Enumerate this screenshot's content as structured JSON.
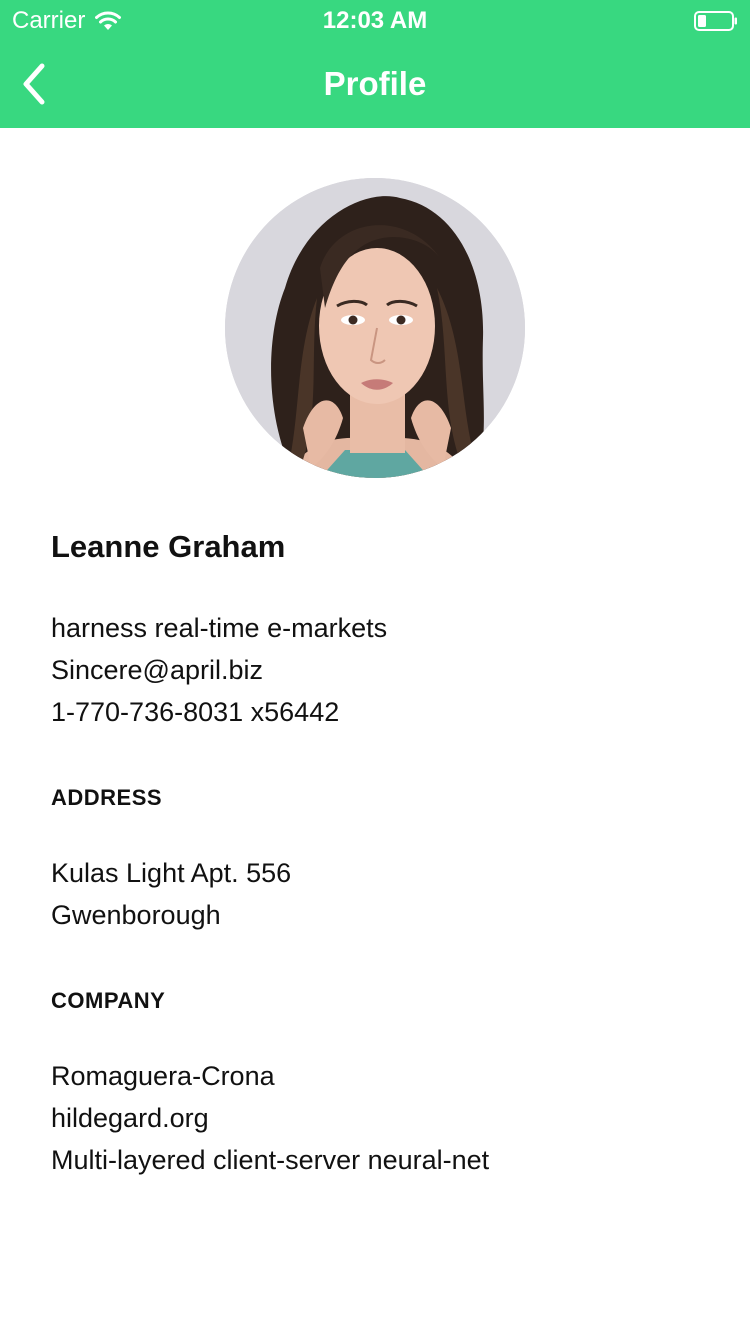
{
  "status_bar": {
    "carrier": "Carrier",
    "time": "12:03 AM",
    "battery_level": 0.25
  },
  "nav": {
    "title": "Profile",
    "back_icon": "chevron-left-icon"
  },
  "colors": {
    "header_bg": "#38d880",
    "header_text": "#ffffff",
    "body_text": "#111111"
  },
  "profile": {
    "name": "Leanne Graham",
    "catch_phrase": "harness real-time e-markets",
    "email": "Sincere@april.biz",
    "phone": "1-770-736-8031 x56442"
  },
  "address": {
    "label": "ADDRESS",
    "street": "Kulas Light Apt. 556",
    "city": "Gwenborough"
  },
  "company": {
    "label": "COMPANY",
    "name": "Romaguera-Crona",
    "website": "hildegard.org",
    "tagline": "Multi-layered client-server neural-net"
  }
}
